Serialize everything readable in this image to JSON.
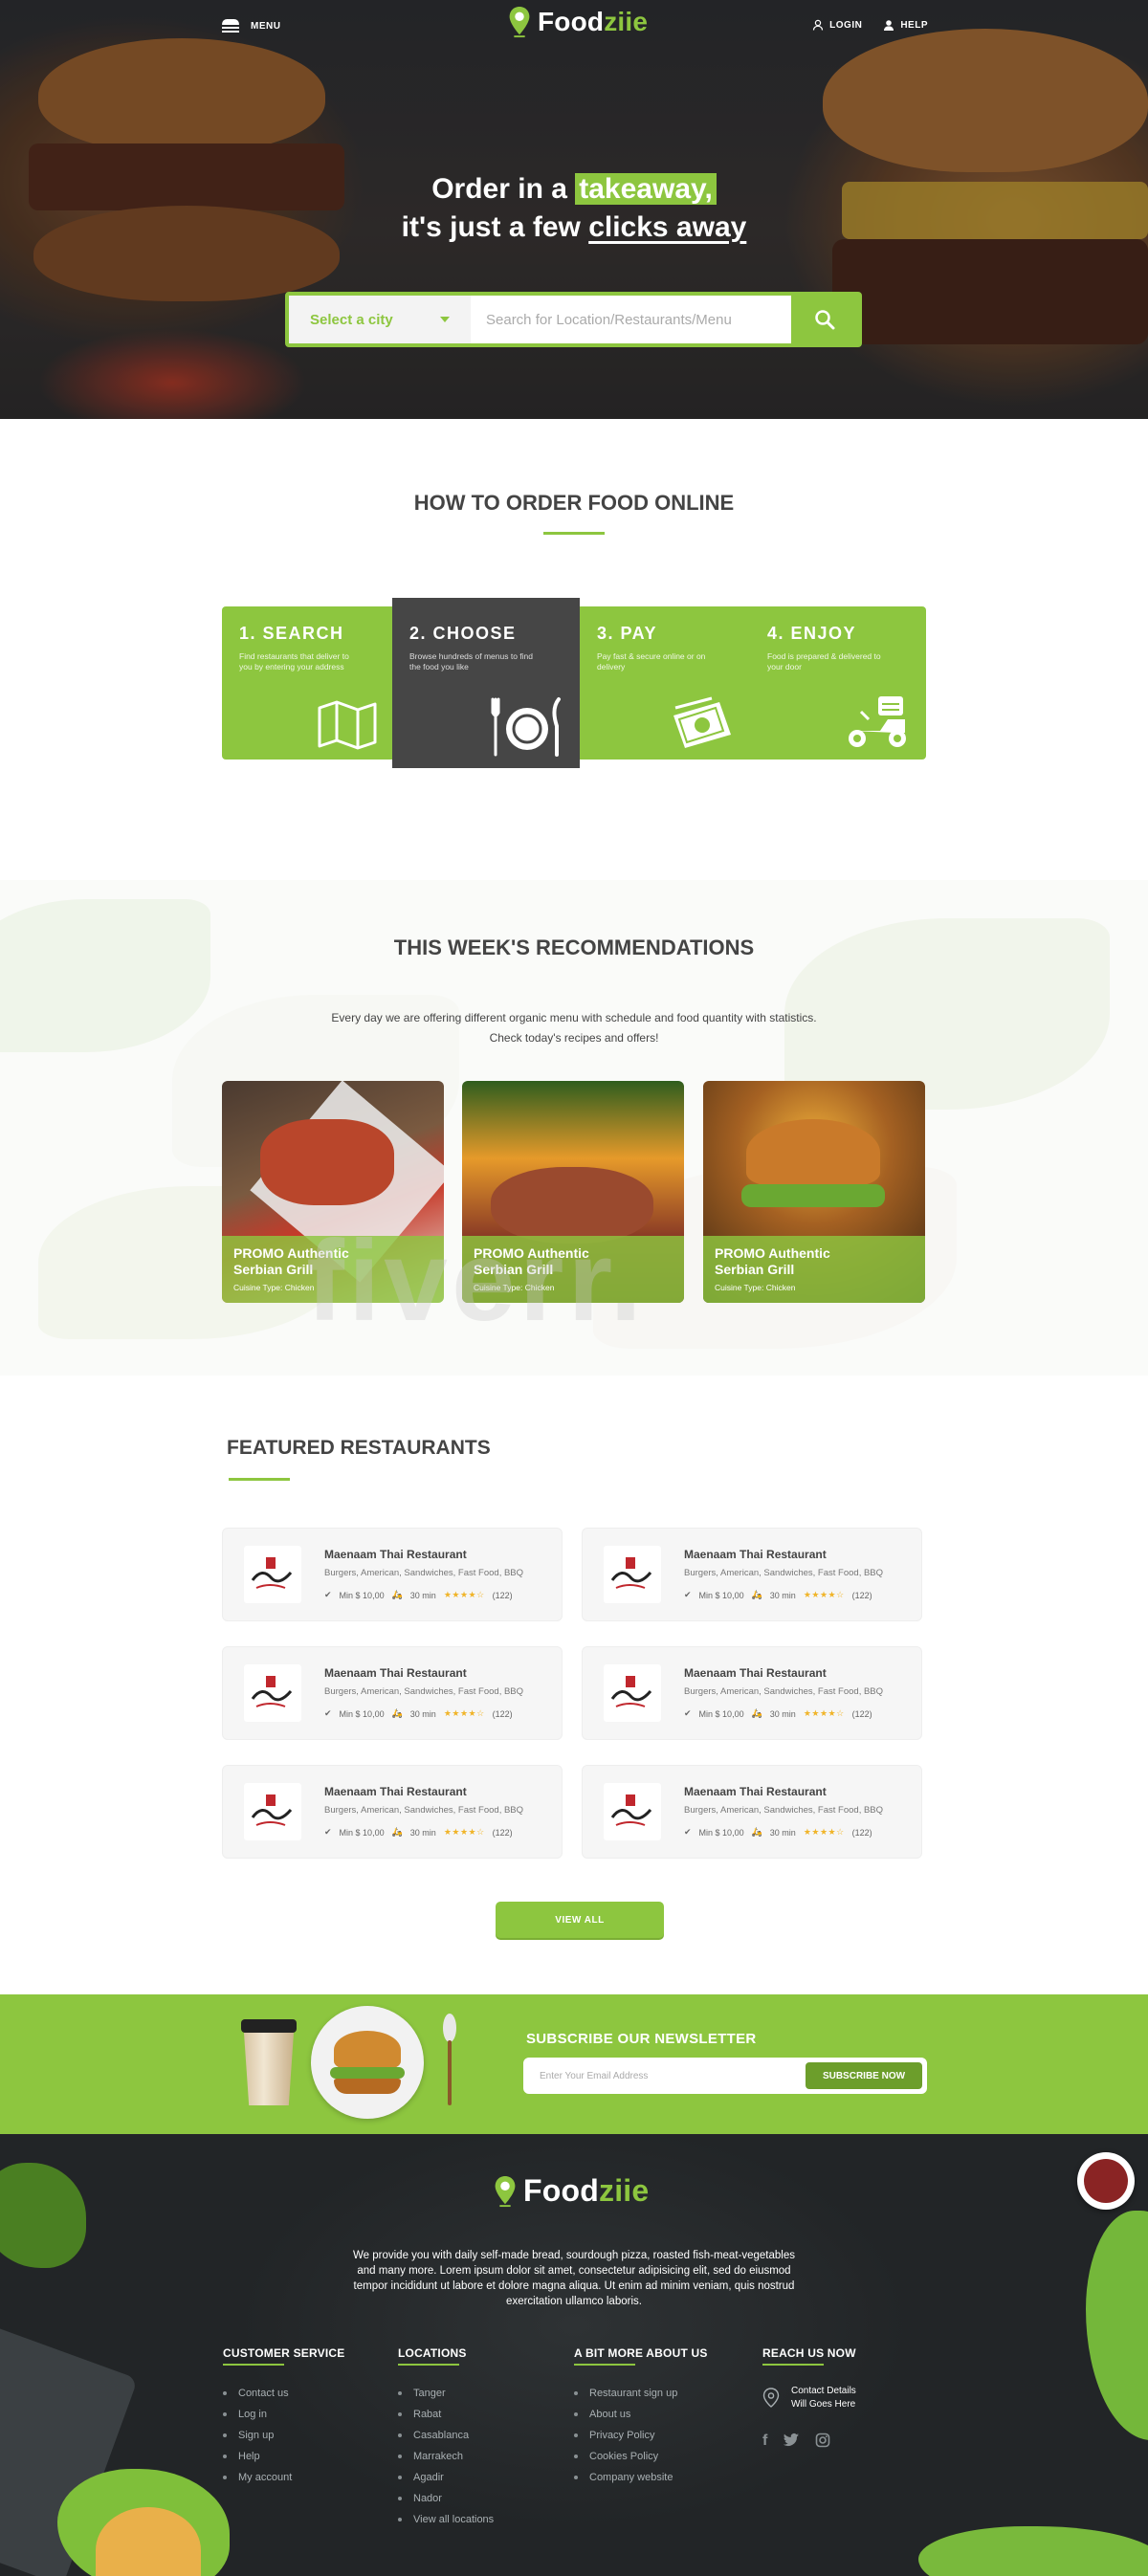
{
  "header": {
    "menu_label": "MENU",
    "logo_text_main": "Food",
    "logo_text_accent": "ziie",
    "login_label": "LOGIN",
    "help_label": "HELP"
  },
  "hero": {
    "line1_pre": "Order in a ",
    "line1_highlight": "takeaway,",
    "line2_pre": "it's just a few ",
    "line2_underline": "clicks away",
    "city_select": "Select a city",
    "search_placeholder": "Search for Location/Restaurants/Menu"
  },
  "how_to": {
    "title": "HOW TO ORDER FOOD ONLINE",
    "steps": [
      {
        "title": "1. SEARCH",
        "desc": "Find restaurants that deliver to you by entering your address",
        "icon": "map-icon"
      },
      {
        "title": "2. CHOOSE",
        "desc": "Browse hundreds of menus to find the food you like",
        "icon": "plate-cutlery-icon"
      },
      {
        "title": "3. PAY",
        "desc": "Pay fast & secure online or on delivery",
        "icon": "cash-icon"
      },
      {
        "title": "4. ENJOY",
        "desc": "Food is prepared & delivered to your door",
        "icon": "delivery-scooter-icon"
      }
    ]
  },
  "recommendations": {
    "title": "THIS WEEK'S RECOMMENDATIONS",
    "desc_line1": "Every day we are offering different organic menu with schedule and food quantity with statistics.",
    "desc_line2": "Check today's recipes and offers!",
    "watermark": "fiverr.",
    "cards": [
      {
        "title": "PROMO Authentic Serbian Grill",
        "sub": "Cuisine Type: Chicken"
      },
      {
        "title": "PROMO Authentic Serbian Grill",
        "sub": "Cuisine Type: Chicken"
      },
      {
        "title": "PROMO Authentic Serbian Grill",
        "sub": "Cuisine Type: Chicken"
      }
    ]
  },
  "featured": {
    "title": "FEATURED RESTAURANTS",
    "restaurants": [
      {
        "name": "Maenaam Thai Restaurant",
        "cuisine": "Burgers, American, Sandwiches, Fast Food, BBQ",
        "min": "Min $ 10,00",
        "time": "30 min",
        "stars": "★★★★☆",
        "reviews": "(122)"
      },
      {
        "name": "Maenaam Thai Restaurant",
        "cuisine": "Burgers, American, Sandwiches, Fast Food, BBQ",
        "min": "Min $ 10,00",
        "time": "30 min",
        "stars": "★★★★☆",
        "reviews": "(122)"
      },
      {
        "name": "Maenaam Thai Restaurant",
        "cuisine": "Burgers, American, Sandwiches, Fast Food, BBQ",
        "min": "Min $ 10,00",
        "time": "30 min",
        "stars": "★★★★☆",
        "reviews": "(122)"
      },
      {
        "name": "Maenaam Thai Restaurant",
        "cuisine": "Burgers, American, Sandwiches, Fast Food, BBQ",
        "min": "Min $ 10,00",
        "time": "30 min",
        "stars": "★★★★☆",
        "reviews": "(122)"
      },
      {
        "name": "Maenaam Thai Restaurant",
        "cuisine": "Burgers, American, Sandwiches, Fast Food, BBQ",
        "min": "Min $ 10,00",
        "time": "30 min",
        "stars": "★★★★☆",
        "reviews": "(122)"
      },
      {
        "name": "Maenaam Thai Restaurant",
        "cuisine": "Burgers, American, Sandwiches, Fast Food, BBQ",
        "min": "Min $ 10,00",
        "time": "30 min",
        "stars": "★★★★☆",
        "reviews": "(122)"
      }
    ],
    "view_all": "VIEW ALL"
  },
  "newsletter": {
    "title": "SUBSCRIBE OUR NEWSLETTER",
    "placeholder": "Enter Your Email Address",
    "button": "SUBSCRIBE NOW"
  },
  "footer": {
    "logo_text_main": "Food",
    "logo_text_accent": "ziie",
    "desc": "We provide you with daily self-made bread, sourdough pizza, roasted fish-meat-vegetables and many more. Lorem ipsum dolor sit amet, consectetur adipisicing elit, sed do eiusmod tempor incididunt ut labore et dolore magna aliqua. Ut enim ad minim veniam, quis nostrud exercitation ullamco laboris.",
    "columns": [
      {
        "title": "CUSTOMER SERVICE",
        "items": [
          "Contact us",
          "Log in",
          "Sign up",
          "Help",
          "My account"
        ]
      },
      {
        "title": "LOCATIONS",
        "items": [
          "Tanger",
          "Rabat",
          "Casablanca",
          "Marrakech",
          "Agadir",
          "Nador",
          "View all locations"
        ]
      },
      {
        "title": "A BIT MORE ABOUT US",
        "items": [
          "Restaurant sign up",
          "About us",
          "Privacy Policy",
          "Cookies Policy",
          "Company website"
        ]
      }
    ],
    "reach": {
      "title": "REACH US NOW",
      "line1": "Contact Details",
      "line2": "Will Goes Here"
    },
    "socials": [
      "facebook-icon",
      "twitter-icon",
      "instagram-icon"
    ]
  },
  "colors": {
    "accent": "#8dc63f",
    "dark": "#464646",
    "footer_bg": "#222527"
  }
}
